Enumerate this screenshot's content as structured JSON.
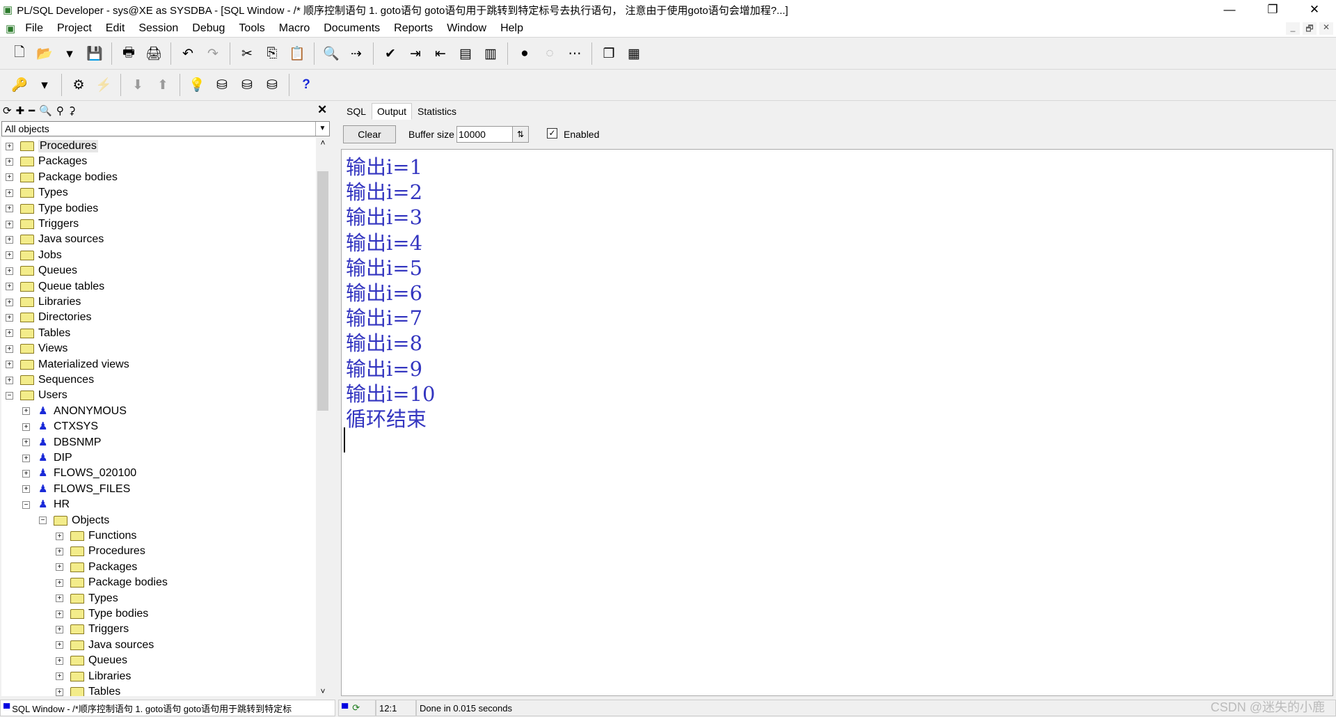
{
  "titlebar": {
    "title": "PL/SQL Developer - sys@XE as SYSDBA - [SQL Window - /* 顺序控制语句 1. goto语句 goto语句用于跳转到特定标号去执行语句，  注意由于使用goto语句会增加程?...]",
    "minimize": "—",
    "restore": "❐",
    "close": "✕"
  },
  "menu": [
    "File",
    "Project",
    "Edit",
    "Session",
    "Debug",
    "Tools",
    "Macro",
    "Documents",
    "Reports",
    "Window",
    "Help"
  ],
  "mdi": {
    "minimize": "_",
    "restore": "🗗",
    "close": "✕"
  },
  "toolbar1": [
    {
      "icon": "new-icon",
      "g": "🗋"
    },
    {
      "icon": "open-icon",
      "g": "📂"
    },
    {
      "icon": "dropdown-icon",
      "g": "▾"
    },
    {
      "icon": "save-icon",
      "g": "💾"
    },
    {
      "sep": true
    },
    {
      "icon": "print-icon",
      "g": "🖶"
    },
    {
      "icon": "print-preview-icon",
      "g": "🖨"
    },
    {
      "sep": true
    },
    {
      "icon": "undo-icon",
      "g": "↶"
    },
    {
      "icon": "redo-icon",
      "g": "↷",
      "dis": true
    },
    {
      "sep": true
    },
    {
      "icon": "cut-icon",
      "g": "✂"
    },
    {
      "icon": "copy-icon",
      "g": "⎘"
    },
    {
      "icon": "paste-icon",
      "g": "📋"
    },
    {
      "sep": true
    },
    {
      "icon": "find-icon",
      "g": "🔍"
    },
    {
      "icon": "find-next-icon",
      "g": "⇢"
    },
    {
      "sep": true
    },
    {
      "icon": "execute-icon",
      "g": "✔"
    },
    {
      "icon": "indent-icon",
      "g": "⇥"
    },
    {
      "icon": "unindent-icon",
      "g": "⇤"
    },
    {
      "icon": "comment-icon",
      "g": "▤"
    },
    {
      "icon": "uncomment-icon",
      "g": "▥"
    },
    {
      "sep": true
    },
    {
      "icon": "breakpoint-icon",
      "g": "●"
    },
    {
      "icon": "breakpoint-disabled-icon",
      "g": "◌",
      "dis": true
    },
    {
      "icon": "breakpoint-condition-icon",
      "g": "⋯"
    },
    {
      "sep": true
    },
    {
      "icon": "cascade-windows-icon",
      "g": "❐"
    },
    {
      "icon": "tile-windows-icon",
      "g": "▦"
    }
  ],
  "toolbar2": [
    {
      "icon": "key-icon",
      "g": "🔑"
    },
    {
      "icon": "dropdown-icon",
      "g": "▾"
    },
    {
      "sep": true
    },
    {
      "icon": "compile-icon",
      "g": "⚙"
    },
    {
      "icon": "break-icon",
      "g": "⚡",
      "dis": true
    },
    {
      "sep": true
    },
    {
      "icon": "commit-icon",
      "g": "⬇",
      "dis": true
    },
    {
      "icon": "rollback-icon",
      "g": "⬆",
      "dis": true
    },
    {
      "sep": true
    },
    {
      "icon": "explain-plan-icon",
      "g": "💡"
    },
    {
      "icon": "sql-trace-icon",
      "g": "⛁"
    },
    {
      "icon": "query-db-icon",
      "g": "⛁"
    },
    {
      "icon": "logoff-icon",
      "g": "⛁"
    },
    {
      "sep": true
    },
    {
      "icon": "help-icon",
      "g": "?"
    }
  ],
  "treetools": [
    {
      "icon": "refresh-icon",
      "g": "⟳"
    },
    {
      "icon": "expand-icon",
      "g": "✚"
    },
    {
      "icon": "collapse-icon",
      "g": "━"
    },
    {
      "icon": "find-icon",
      "g": "🔍"
    },
    {
      "icon": "filter-icon",
      "g": "⚲"
    },
    {
      "icon": "filter-edit-icon",
      "g": "⚳"
    }
  ],
  "browser": {
    "filter": "All objects",
    "close": "✕"
  },
  "tree": [
    {
      "l": 0,
      "t": "Procedures",
      "k": "folder",
      "sel": true
    },
    {
      "l": 0,
      "t": "Packages",
      "k": "folder"
    },
    {
      "l": 0,
      "t": "Package bodies",
      "k": "folder"
    },
    {
      "l": 0,
      "t": "Types",
      "k": "folder"
    },
    {
      "l": 0,
      "t": "Type bodies",
      "k": "folder"
    },
    {
      "l": 0,
      "t": "Triggers",
      "k": "folder"
    },
    {
      "l": 0,
      "t": "Java sources",
      "k": "folder"
    },
    {
      "l": 0,
      "t": "Jobs",
      "k": "folder"
    },
    {
      "l": 0,
      "t": "Queues",
      "k": "folder"
    },
    {
      "l": 0,
      "t": "Queue tables",
      "k": "folder"
    },
    {
      "l": 0,
      "t": "Libraries",
      "k": "folder"
    },
    {
      "l": 0,
      "t": "Directories",
      "k": "folder"
    },
    {
      "l": 0,
      "t": "Tables",
      "k": "folder"
    },
    {
      "l": 0,
      "t": "Views",
      "k": "folder"
    },
    {
      "l": 0,
      "t": "Materialized views",
      "k": "folder"
    },
    {
      "l": 0,
      "t": "Sequences",
      "k": "folder"
    },
    {
      "l": 0,
      "t": "Users",
      "k": "folder",
      "open": true
    },
    {
      "l": 1,
      "t": "ANONYMOUS",
      "k": "user"
    },
    {
      "l": 1,
      "t": "CTXSYS",
      "k": "user"
    },
    {
      "l": 1,
      "t": "DBSNMP",
      "k": "user"
    },
    {
      "l": 1,
      "t": "DIP",
      "k": "user"
    },
    {
      "l": 1,
      "t": "FLOWS_020100",
      "k": "user"
    },
    {
      "l": 1,
      "t": "FLOWS_FILES",
      "k": "user"
    },
    {
      "l": 1,
      "t": "HR",
      "k": "user",
      "open": true
    },
    {
      "l": 2,
      "t": "Objects",
      "k": "folder",
      "open": true
    },
    {
      "l": 3,
      "t": "Functions",
      "k": "folder"
    },
    {
      "l": 3,
      "t": "Procedures",
      "k": "folder"
    },
    {
      "l": 3,
      "t": "Packages",
      "k": "folder"
    },
    {
      "l": 3,
      "t": "Package bodies",
      "k": "folder"
    },
    {
      "l": 3,
      "t": "Types",
      "k": "folder"
    },
    {
      "l": 3,
      "t": "Type bodies",
      "k": "folder"
    },
    {
      "l": 3,
      "t": "Triggers",
      "k": "folder"
    },
    {
      "l": 3,
      "t": "Java sources",
      "k": "folder"
    },
    {
      "l": 3,
      "t": "Queues",
      "k": "folder"
    },
    {
      "l": 3,
      "t": "Libraries",
      "k": "folder"
    },
    {
      "l": 3,
      "t": "Tables",
      "k": "folder"
    }
  ],
  "tabs": [
    {
      "label": "SQL"
    },
    {
      "label": "Output",
      "active": true
    },
    {
      "label": "Statistics"
    }
  ],
  "output_controls": {
    "clear": "Clear",
    "buffer_label": "Buffer size",
    "buffer_value": "10000",
    "enabled_label": "Enabled",
    "enabled": true
  },
  "output_lines": [
    "输出i=1",
    "输出i=2",
    "输出i=3",
    "输出i=4",
    "输出i=5",
    "输出i=6",
    "输出i=7",
    "输出i=8",
    "输出i=9",
    "输出i=10",
    "循环结束"
  ],
  "status": {
    "window": "SQL Window - /*顺序控制语句 1. goto语句 goto语句用于跳转到特定标",
    "position": "12:1",
    "message": "Done in 0.015 seconds"
  },
  "watermark": "CSDN @迷失的小鹿",
  "colors": {
    "output_text": "#3436c0"
  }
}
